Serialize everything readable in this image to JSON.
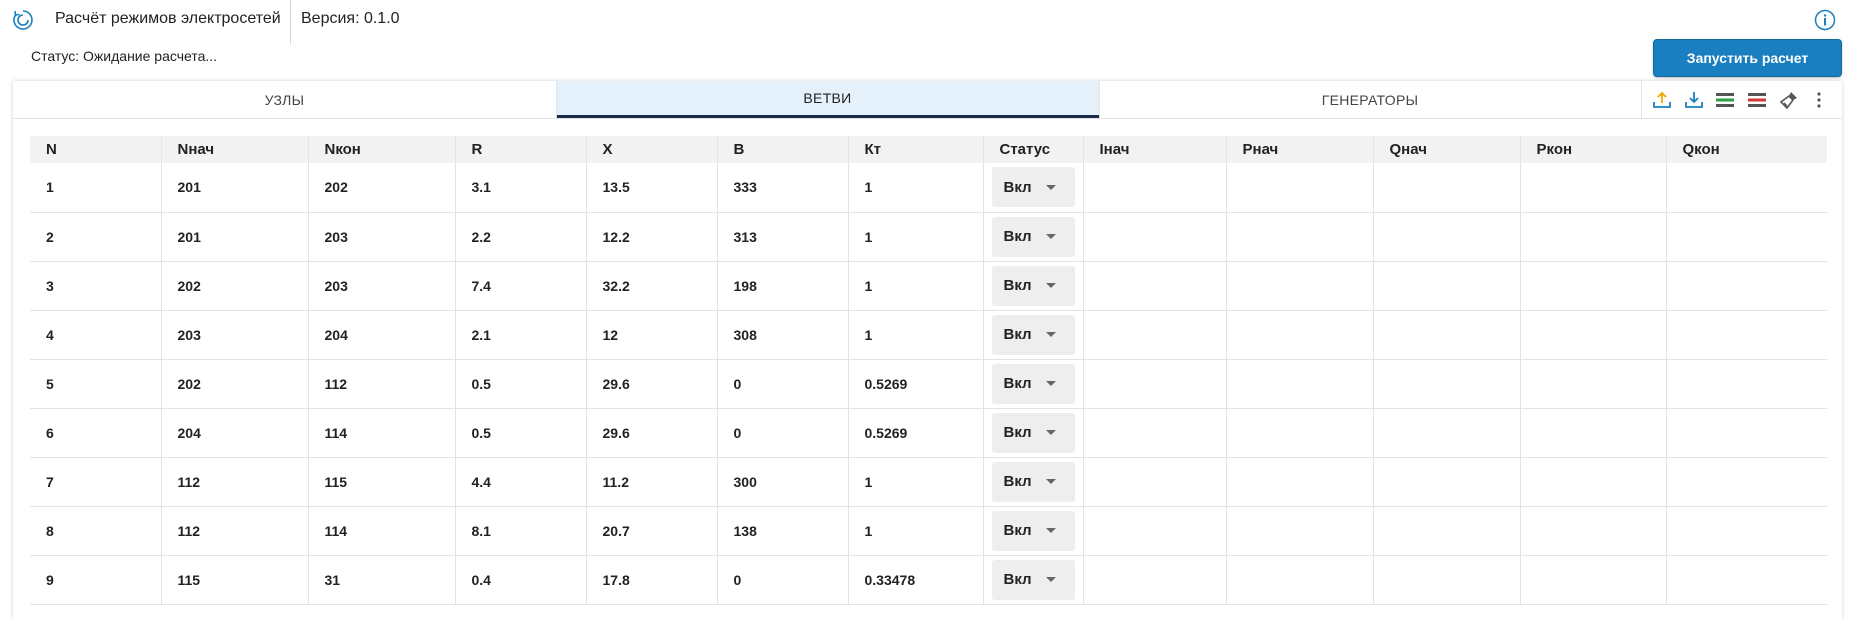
{
  "header": {
    "title": "Расчёт режимов электросетей",
    "version": "Версия: 0.1.0"
  },
  "status_text": "Статус: Ожидание расчета...",
  "run_button": "Запустить расчет",
  "tabs": [
    {
      "label": "УЗЛЫ",
      "active": false
    },
    {
      "label": "ВЕТВИ",
      "active": true
    },
    {
      "label": "ГЕНЕРАТОРЫ",
      "active": false
    }
  ],
  "toolbar": [
    "upload-icon",
    "download-icon",
    "add-row-icon",
    "delete-row-icon",
    "clear-brush-icon",
    "more-vert-icon"
  ],
  "colors": {
    "accent": "#1a7fc0",
    "active_tab_bg": "#e4f1fb",
    "active_tab_underline": "#1a2e4a",
    "upload": "#f2a900",
    "download": "#1a7fc0",
    "add": "#2e9e44",
    "delete": "#d0383a"
  },
  "table": {
    "columns": [
      "N",
      "Nнач",
      "Nкон",
      "R",
      "X",
      "B",
      "Кт",
      "Статус",
      "Iнач",
      "Pнач",
      "Qнач",
      "Pкон",
      "Qкон"
    ],
    "rows": [
      [
        "1",
        "201",
        "202",
        "3.1",
        "13.5",
        "333",
        "1",
        "Вкл",
        "",
        "",
        "",
        "",
        ""
      ],
      [
        "2",
        "201",
        "203",
        "2.2",
        "12.2",
        "313",
        "1",
        "Вкл",
        "",
        "",
        "",
        "",
        ""
      ],
      [
        "3",
        "202",
        "203",
        "7.4",
        "32.2",
        "198",
        "1",
        "Вкл",
        "",
        "",
        "",
        "",
        ""
      ],
      [
        "4",
        "203",
        "204",
        "2.1",
        "12",
        "308",
        "1",
        "Вкл",
        "",
        "",
        "",
        "",
        ""
      ],
      [
        "5",
        "202",
        "112",
        "0.5",
        "29.6",
        "0",
        "0.5269",
        "Вкл",
        "",
        "",
        "",
        "",
        ""
      ],
      [
        "6",
        "204",
        "114",
        "0.5",
        "29.6",
        "0",
        "0.5269",
        "Вкл",
        "",
        "",
        "",
        "",
        ""
      ],
      [
        "7",
        "112",
        "115",
        "4.4",
        "11.2",
        "300",
        "1",
        "Вкл",
        "",
        "",
        "",
        "",
        ""
      ],
      [
        "8",
        "112",
        "114",
        "8.1",
        "20.7",
        "138",
        "1",
        "Вкл",
        "",
        "",
        "",
        "",
        ""
      ],
      [
        "9",
        "115",
        "31",
        "0.4",
        "17.8",
        "0",
        "0.33478",
        "Вкл",
        "",
        "",
        "",
        "",
        ""
      ]
    ]
  }
}
